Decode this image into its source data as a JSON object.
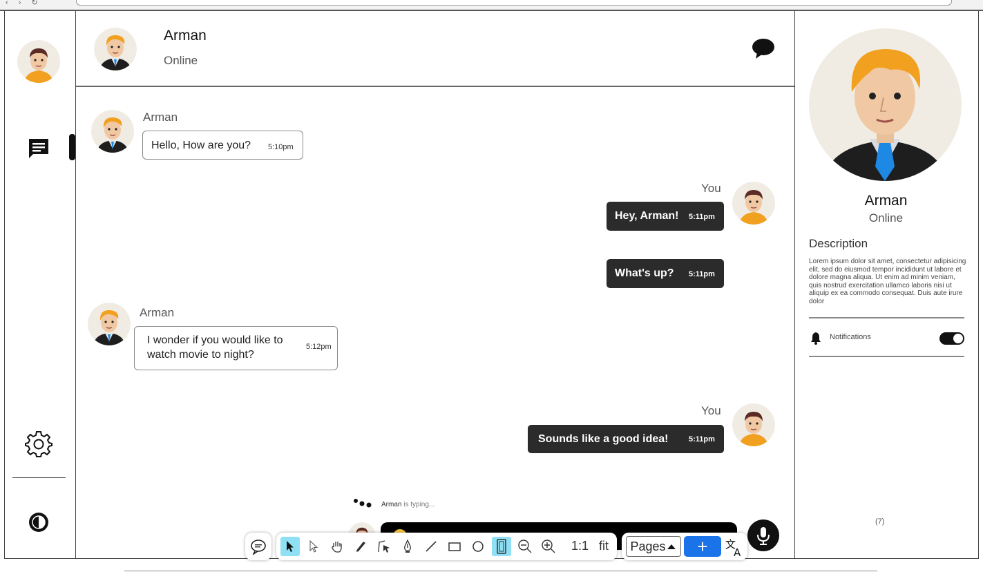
{
  "sidebar": {
    "icons": [
      "user-avatar",
      "chat-icon",
      "gear-icon",
      "contrast-icon"
    ]
  },
  "chat_header": {
    "name": "Arman",
    "status": "Online",
    "icon": "chat-bubble-icon"
  },
  "messages": [
    {
      "direction": "in",
      "sender": "Arman",
      "text": "Hello, How are you?",
      "time": "5:10pm"
    },
    {
      "direction": "out",
      "sender": "You",
      "text": "Hey, Arman!",
      "time": "5:11pm"
    },
    {
      "direction": "out",
      "sender": "",
      "text": "What's up?",
      "time": "5:11pm"
    },
    {
      "direction": "in",
      "sender": "Arman",
      "text_line1": "I wonder if you would like to",
      "text_line2": "watch movie to night?",
      "time": "5:12pm"
    },
    {
      "direction": "out",
      "sender": "You",
      "text": "Sounds like a good idea!",
      "time": "5:11pm"
    }
  ],
  "typing": {
    "name": "Arman",
    "text": "is typing..."
  },
  "toolbar": {
    "zoom_1to1": "1:1",
    "fit": "fit",
    "pages": "Pages",
    "plus": "+",
    "tools": [
      "comment-icon",
      "select-arrow-icon",
      "pointer-icon",
      "hand-icon",
      "pen-icon",
      "path-icon",
      "ink-icon",
      "line-icon",
      "rectangle-icon",
      "ellipse-icon",
      "page-view-icon",
      "zoom-out-icon",
      "zoom-in-icon",
      "translate-icon"
    ]
  },
  "profile": {
    "name": "Arman",
    "status": "Online",
    "description_title": "Description",
    "description": "Lorem ipsum dolor sit amet, consectetur adipisicing elit, sed do eiusmod tempor incididunt ut labore et dolore magna aliqua. Ut enim ad minim veniam, quis nostrud exercitation ullamco laboris nisi ut aliquip ex ea commodo consequat. Duis aute irure dolor",
    "notifications_label": "Notifications",
    "notifications_on": true,
    "count": "(7)"
  },
  "colors": {
    "out_bubble": "#2b2b2b",
    "accent_blue": "#1a73e8",
    "tool_selected": "#8fe0f5"
  }
}
